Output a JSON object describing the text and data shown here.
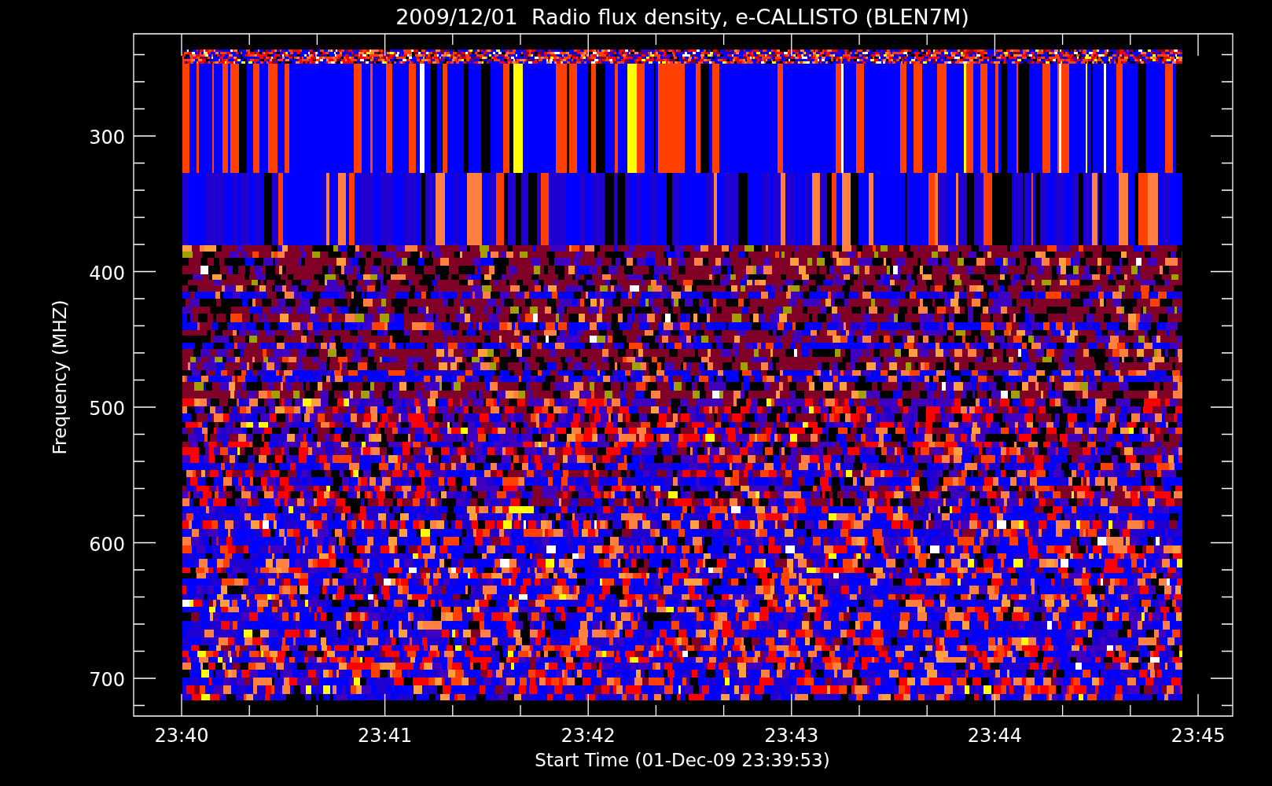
{
  "title": "2009/12/01  Radio flux density, e-CALLISTO (BLEN7M)",
  "y_axis": {
    "label": "Frequency (MHZ)",
    "ticks": [
      "300",
      "400",
      "500",
      "600",
      "700"
    ]
  },
  "x_axis": {
    "label": "Start Time (01-Dec-09 23:39:53)",
    "ticks": [
      "23:40",
      "23:41",
      "23:42",
      "23:43",
      "23:44",
      "23:45"
    ]
  }
}
